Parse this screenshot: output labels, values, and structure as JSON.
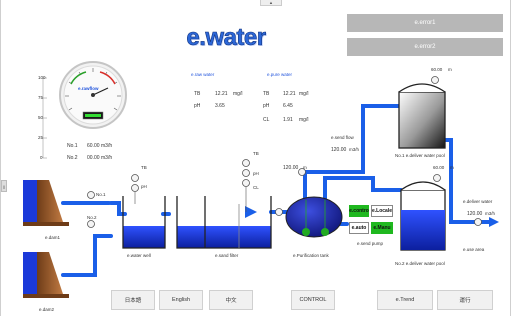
{
  "app": {
    "title": "e.water",
    "top_tab": "▲",
    "side_tab": "||"
  },
  "errors": {
    "error1": "e.error1",
    "error2": "e.error2"
  },
  "gauge": {
    "label": "e.rawflow",
    "scale": [
      "100",
      "75",
      "50",
      "25",
      "0"
    ],
    "readout_value": 0.6,
    "no1_label": "No.1",
    "no1_value": "60.00",
    "no1_unit": "m3/h",
    "no2_label": "No.2",
    "no2_value": "00.00",
    "no2_unit": "m3/h"
  },
  "raw_water": {
    "title": "e.raw water",
    "tb_label": "TB",
    "tb_value": "12.21",
    "tb_unit": "mg/l",
    "ph_label": "pH",
    "ph_value": "3.65"
  },
  "pure_water": {
    "title": "e.pure water",
    "tb_label": "TB",
    "tb_value": "12.21",
    "tb_unit": "mg/l",
    "ph_label": "pH",
    "ph_value": "6.45",
    "cl_label": "CL",
    "cl_value": "1.91",
    "cl_unit": "mg/l"
  },
  "pool1": {
    "level_label": "60.00",
    "level_unit": "m",
    "name": "No.1 e.deliver water pool"
  },
  "pool2": {
    "level_label": "60.00",
    "level_unit": "m",
    "name": "No.2 e.deliver water pool"
  },
  "send_flow": {
    "label": "e.send flow",
    "value": "120.00",
    "unit": "m3/h"
  },
  "send_pump": {
    "label": "e.send pump"
  },
  "purify": {
    "value": "120.00",
    "unit": "m",
    "name": "e.Purification tank"
  },
  "deliver": {
    "label": "e.deliver water",
    "value": "120.00",
    "unit": "m3/h",
    "area": "e.use area"
  },
  "sensors": {
    "tb": "TB",
    "ph": "pH",
    "cl": "CL",
    "no1": "No.1",
    "no2": "No.2"
  },
  "labels": {
    "dam1": "e.dam1",
    "dam2": "e.dam2",
    "water_well": "e.water well",
    "sand_filter": "e.sand filter"
  },
  "mini_buttons": {
    "contro": "e.contro",
    "locale": "e.Locale",
    "auto": "e.auto",
    "manu": "e.Manu"
  },
  "bottom": {
    "japanese": "日本語",
    "english": "English",
    "chinese": "中文",
    "control": "CONTROL",
    "trend": "e.Trend",
    "run": "運行"
  },
  "colors": {
    "water": "#1b39d9",
    "pipe": "#1a5fe8",
    "title": "#2c67d8",
    "dam": "#9a5a2c",
    "error_button": "#b7b7b7",
    "green_button": "#1fb81f"
  }
}
